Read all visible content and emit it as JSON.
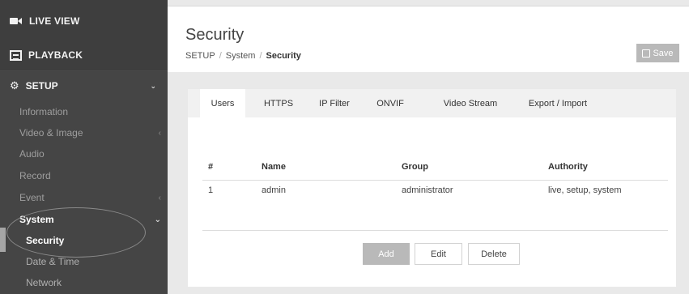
{
  "sidebar": {
    "live_view": "LIVE VIEW",
    "playback": "PLAYBACK",
    "setup": "SETUP",
    "items": [
      {
        "label": "Information"
      },
      {
        "label": "Video & Image"
      },
      {
        "label": "Audio"
      },
      {
        "label": "Record"
      },
      {
        "label": "Event"
      },
      {
        "label": "System"
      },
      {
        "label": "Security"
      },
      {
        "label": "Date & Time"
      },
      {
        "label": "Network"
      }
    ]
  },
  "header": {
    "title": "Security",
    "breadcrumb": [
      "SETUP",
      "System",
      "Security"
    ],
    "save_label": "Save"
  },
  "tabs": [
    "Users",
    "HTTPS",
    "IP Filter",
    "ONVIF",
    "Video Stream",
    "Export / Import"
  ],
  "table": {
    "columns": [
      "#",
      "Name",
      "Group",
      "Authority"
    ],
    "rows": [
      [
        "1",
        "admin",
        "administrator",
        "live, setup, system"
      ]
    ]
  },
  "buttons": {
    "add": "Add",
    "edit": "Edit",
    "delete": "Delete"
  }
}
